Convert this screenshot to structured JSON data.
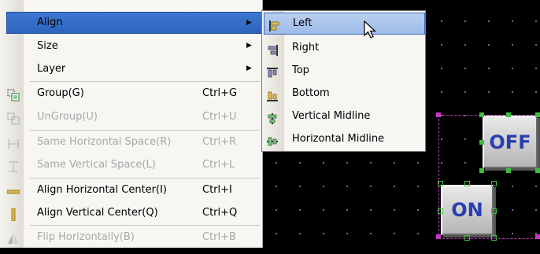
{
  "main_menu": {
    "items": [
      {
        "label": "Align",
        "shortcut": "",
        "submenu": true,
        "disabled": false,
        "highlighted": true,
        "icon": ""
      },
      {
        "label": "Size",
        "shortcut": "",
        "submenu": true,
        "disabled": false,
        "icon": ""
      },
      {
        "label": "Layer",
        "shortcut": "",
        "submenu": true,
        "disabled": false,
        "icon": ""
      },
      {
        "label": "Group(G)",
        "shortcut": "Ctrl+G",
        "disabled": false,
        "icon": "group-icon"
      },
      {
        "label": "UnGroup(U)",
        "shortcut": "Ctrl+U",
        "disabled": true,
        "icon": "ungroup-icon"
      },
      {
        "label": "Same Horizontal Space(R)",
        "shortcut": "Ctrl+R",
        "disabled": true,
        "icon": "same-horizontal-space-icon"
      },
      {
        "label": "Same Vertical Space(L)",
        "shortcut": "Ctrl+L",
        "disabled": true,
        "icon": "same-vertical-space-icon"
      },
      {
        "label": "Align Horizontal Center(I)",
        "shortcut": "Ctrl+I",
        "disabled": false,
        "icon": "align-horizontal-center-icon"
      },
      {
        "label": "Align Vertical Center(Q)",
        "shortcut": "Ctrl+Q",
        "disabled": false,
        "icon": "align-vertical-center-icon"
      },
      {
        "label": "Flip Horizontally(B)",
        "shortcut": "Ctrl+B",
        "disabled": true,
        "icon": "flip-horizontally-icon"
      }
    ],
    "submenu_arrow": "▶"
  },
  "align_submenu": {
    "items": [
      {
        "label": "Left",
        "icon": "align-left-icon",
        "highlighted": true
      },
      {
        "label": "Right",
        "icon": "align-right-icon"
      },
      {
        "label": "Top",
        "icon": "align-top-icon"
      },
      {
        "label": "Bottom",
        "icon": "align-bottom-icon"
      },
      {
        "label": "Vertical Midline",
        "icon": "vertical-midline-icon"
      },
      {
        "label": "Horizontal Midline",
        "icon": "horizontal-midline-icon"
      }
    ]
  },
  "canvas": {
    "off_button_label": "OFF",
    "on_button_label": "ON"
  },
  "colors": {
    "highlight": "#316ac5",
    "sub_highlight": "#b9cff0",
    "selection": "#c03ac0",
    "handle": "#3fbf3f",
    "button_text": "#2a3eb0"
  }
}
